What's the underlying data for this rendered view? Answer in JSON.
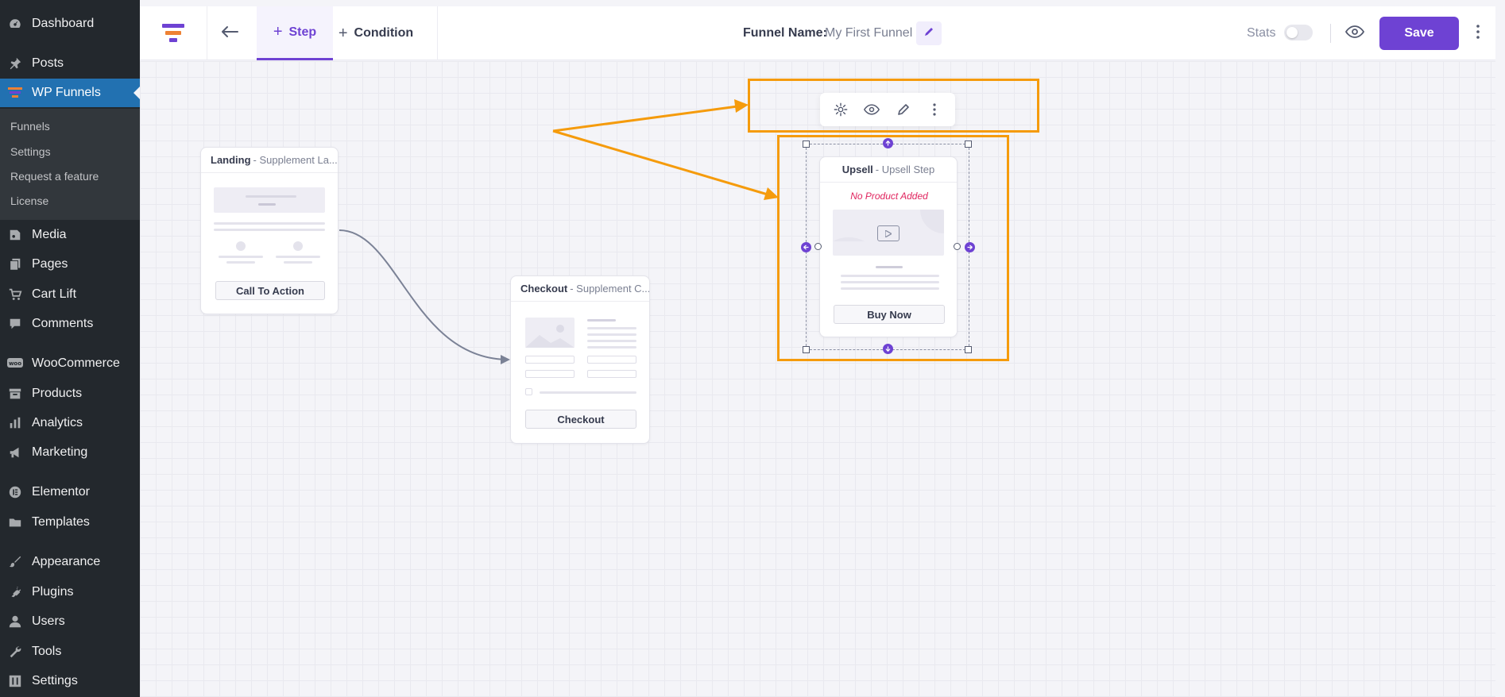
{
  "sidebar": {
    "items": [
      {
        "label": "Dashboard",
        "icon": "dashboard-icon"
      },
      {
        "label": "Posts",
        "icon": "pin-icon"
      },
      {
        "label": "WP Funnels",
        "icon": "funnel-icon"
      },
      {
        "label": "Media",
        "icon": "media-icon"
      },
      {
        "label": "Pages",
        "icon": "pages-icon"
      },
      {
        "label": "Cart Lift",
        "icon": "cart-icon"
      },
      {
        "label": "Comments",
        "icon": "comment-icon"
      },
      {
        "label": "WooCommerce",
        "icon": "woo-icon"
      },
      {
        "label": "Products",
        "icon": "archive-icon"
      },
      {
        "label": "Analytics",
        "icon": "bar-chart-icon"
      },
      {
        "label": "Marketing",
        "icon": "megaphone-icon"
      },
      {
        "label": "Elementor",
        "icon": "elementor-icon"
      },
      {
        "label": "Templates",
        "icon": "folder-icon"
      },
      {
        "label": "Appearance",
        "icon": "brush-icon"
      },
      {
        "label": "Plugins",
        "icon": "plugin-icon"
      },
      {
        "label": "Users",
        "icon": "user-icon"
      },
      {
        "label": "Tools",
        "icon": "wrench-icon"
      },
      {
        "label": "Settings",
        "icon": "settings-icon"
      }
    ],
    "submenu": [
      "Funnels",
      "Settings",
      "Request a feature",
      "License"
    ]
  },
  "topbar": {
    "tab_step": "Step",
    "tab_condition": "Condition",
    "funnel_name_label": "Funnel Name:",
    "funnel_name_value": "My First Funnel",
    "stats_label": "Stats",
    "stats_enabled": false,
    "save_label": "Save"
  },
  "nodes": {
    "landing": {
      "type": "Landing",
      "name": "- Supplement La...",
      "button": "Call To Action"
    },
    "checkout": {
      "type": "Checkout",
      "name": "- Supplement C...",
      "button": "Checkout"
    },
    "upsell": {
      "type": "Upsell",
      "name": "- Upsell Step",
      "notice": "No Product Added",
      "button": "Buy Now"
    }
  },
  "colors": {
    "accent": "#6e42d3",
    "wp_active": "#2271b1",
    "annotation": "#f59b0c",
    "notice": "#e0245e"
  }
}
